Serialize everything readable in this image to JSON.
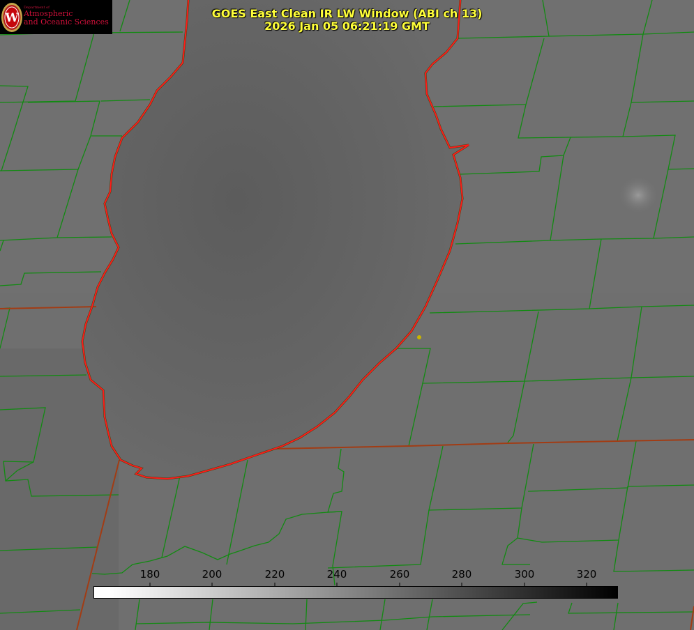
{
  "title": {
    "line1": "GOES East Clean IR LW Window (ABI ch 13)",
    "line2": "2026 Jan 05 06:21:19 GMT"
  },
  "logo": {
    "dept": "Department of",
    "line1": "Atmospheric",
    "line2": "and Oceanic Sciences",
    "emblem_letter": "W"
  },
  "colorbar": {
    "ticks": [
      "180",
      "200",
      "220",
      "240",
      "260",
      "280",
      "300",
      "320"
    ],
    "gradient": "white-to-black",
    "range": [
      162,
      333
    ]
  },
  "colors": {
    "land": "#6f6f6f",
    "lake": "#616161",
    "county_lines": "#0f8f0f",
    "state_lines": "#b03a1a",
    "shoreline": "#ff1a1a",
    "title": "#ffff3a",
    "marker": "#c8b400"
  }
}
